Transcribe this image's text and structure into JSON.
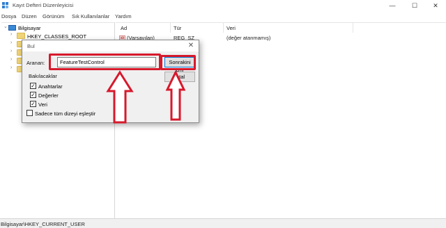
{
  "window": {
    "title": "Kayıt Defteri Düzenleyicisi",
    "icon": "registry-icon",
    "controls": {
      "minimize": "—",
      "maximize": "☐",
      "close": "✕"
    }
  },
  "menu": {
    "items": [
      "Dosya",
      "Düzen",
      "Görünüm",
      "Sık Kullanılanlar",
      "Yardım"
    ]
  },
  "tree": {
    "root": "Bilgisayar",
    "items": [
      {
        "label": "HKEY_CLASSES_ROOT"
      }
    ]
  },
  "list": {
    "columns": [
      "Ad",
      "Tür",
      "Veri"
    ],
    "rows": [
      {
        "name": "(Varsayılan)",
        "type": "REG_SZ",
        "data": "(değer atanmamış)",
        "icon": "string-value-icon"
      }
    ]
  },
  "status": {
    "path": "Bilgisayar\\HKEY_CURRENT_USER"
  },
  "find_dialog": {
    "title": "Bul",
    "close_glyph": "✕",
    "search_label": "Aranan:",
    "search_value": "FeatureTestControl",
    "find_next_label": "Sonrakini Bul",
    "cancel_label": "İptal",
    "look_at_label": "Bakılacaklar",
    "options": [
      {
        "label": "Anahtarlar",
        "checked": true
      },
      {
        "label": "Değerler",
        "checked": true
      },
      {
        "label": "Veri",
        "checked": true
      }
    ],
    "whole_string": {
      "label": "Sadece tüm dizeyi eşleştir",
      "checked": false
    }
  },
  "colors": {
    "annotation_red": "#d7192c",
    "accent_blue": "#0078d7"
  }
}
